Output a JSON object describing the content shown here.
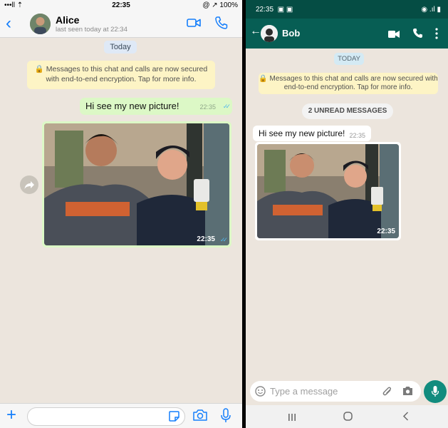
{
  "ios": {
    "status": {
      "signal": "•••ll ⇡",
      "time": "22:35",
      "battery": "@ ↗ 100%"
    },
    "header": {
      "back": "‹",
      "name": "Alice",
      "last_seen": "last seen today at 22:34"
    },
    "chat": {
      "date_badge": "Today",
      "encryption_notice": "🔒 Messages to this chat and calls are now secured with end-to-end encryption. Tap for more info.",
      "messages": [
        {
          "type": "text",
          "direction": "out",
          "text": "Hi see my new picture!",
          "time": "22:35",
          "status": "read"
        },
        {
          "type": "image",
          "direction": "out",
          "time": "22:35",
          "status": "read"
        }
      ]
    },
    "input": {
      "plus": "+",
      "placeholder": ""
    }
  },
  "android": {
    "status": {
      "time": "22:35",
      "icons": "▣ ▣",
      "right": "◉ .ıl ▮"
    },
    "header": {
      "back": "←",
      "name": "Bob"
    },
    "chat": {
      "date_badge": "TODAY",
      "encryption_notice": "🔒 Messages to this chat and calls are now secured with end-to-end encryption. Tap for more info.",
      "unread_badge": "2 UNREAD MESSAGES",
      "messages": [
        {
          "type": "text",
          "direction": "in",
          "text": "Hi see my new picture!",
          "time": "22:35"
        },
        {
          "type": "image",
          "direction": "in",
          "time": "22:35"
        }
      ]
    },
    "input": {
      "placeholder": "Type a message"
    }
  },
  "colors": {
    "wallpaper": "#ece5dd",
    "ios_accent": "#147efb",
    "outgoing_bubble": "#dcf8c6",
    "android_primary": "#075e54",
    "android_fab": "#128c7e",
    "read_ticks": "#4fb6ec"
  }
}
